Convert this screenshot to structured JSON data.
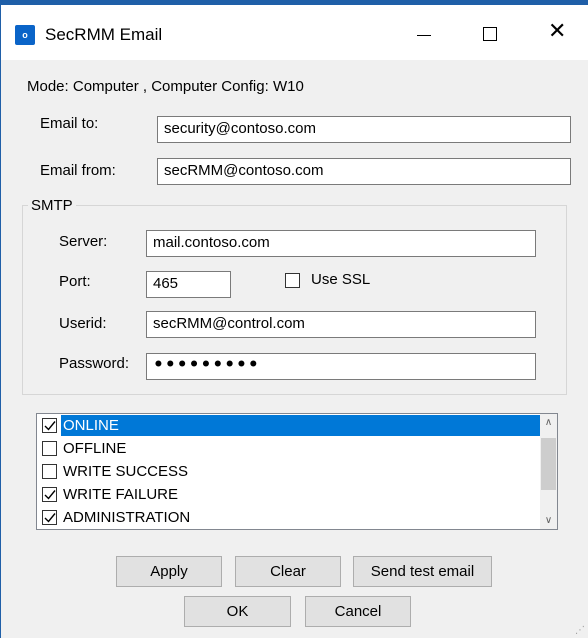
{
  "window": {
    "title": "SecRMM Email",
    "icon": "outlook-mail-icon",
    "icon_text": "o"
  },
  "mode_line": "Mode: Computer , Computer Config: W10",
  "email_to": {
    "label": "Email to:",
    "value": "security@contoso.com"
  },
  "email_from": {
    "label": "Email from:",
    "value": "secRMM@contoso.com"
  },
  "smtp": {
    "legend": "SMTP",
    "server": {
      "label": "Server:",
      "value": "mail.contoso.com"
    },
    "port": {
      "label": "Port:",
      "value": "465"
    },
    "use_ssl": {
      "label": "Use SSL",
      "checked": false
    },
    "userid": {
      "label": "Userid:",
      "value": "secRMM@control.com"
    },
    "password": {
      "label": "Password:",
      "value": "•••••••••"
    }
  },
  "events": [
    {
      "label": "ONLINE",
      "checked": true,
      "selected": true
    },
    {
      "label": "OFFLINE",
      "checked": false,
      "selected": false
    },
    {
      "label": "WRITE SUCCESS",
      "checked": false,
      "selected": false
    },
    {
      "label": "WRITE FAILURE",
      "checked": true,
      "selected": false
    },
    {
      "label": "ADMINISTRATION",
      "checked": true,
      "selected": false
    }
  ],
  "buttons": {
    "apply": "Apply",
    "clear": "Clear",
    "send_test": "Send test email",
    "ok": "OK",
    "cancel": "Cancel"
  },
  "colors": {
    "selection": "#0078d7",
    "accent": "#1f5fa8"
  }
}
